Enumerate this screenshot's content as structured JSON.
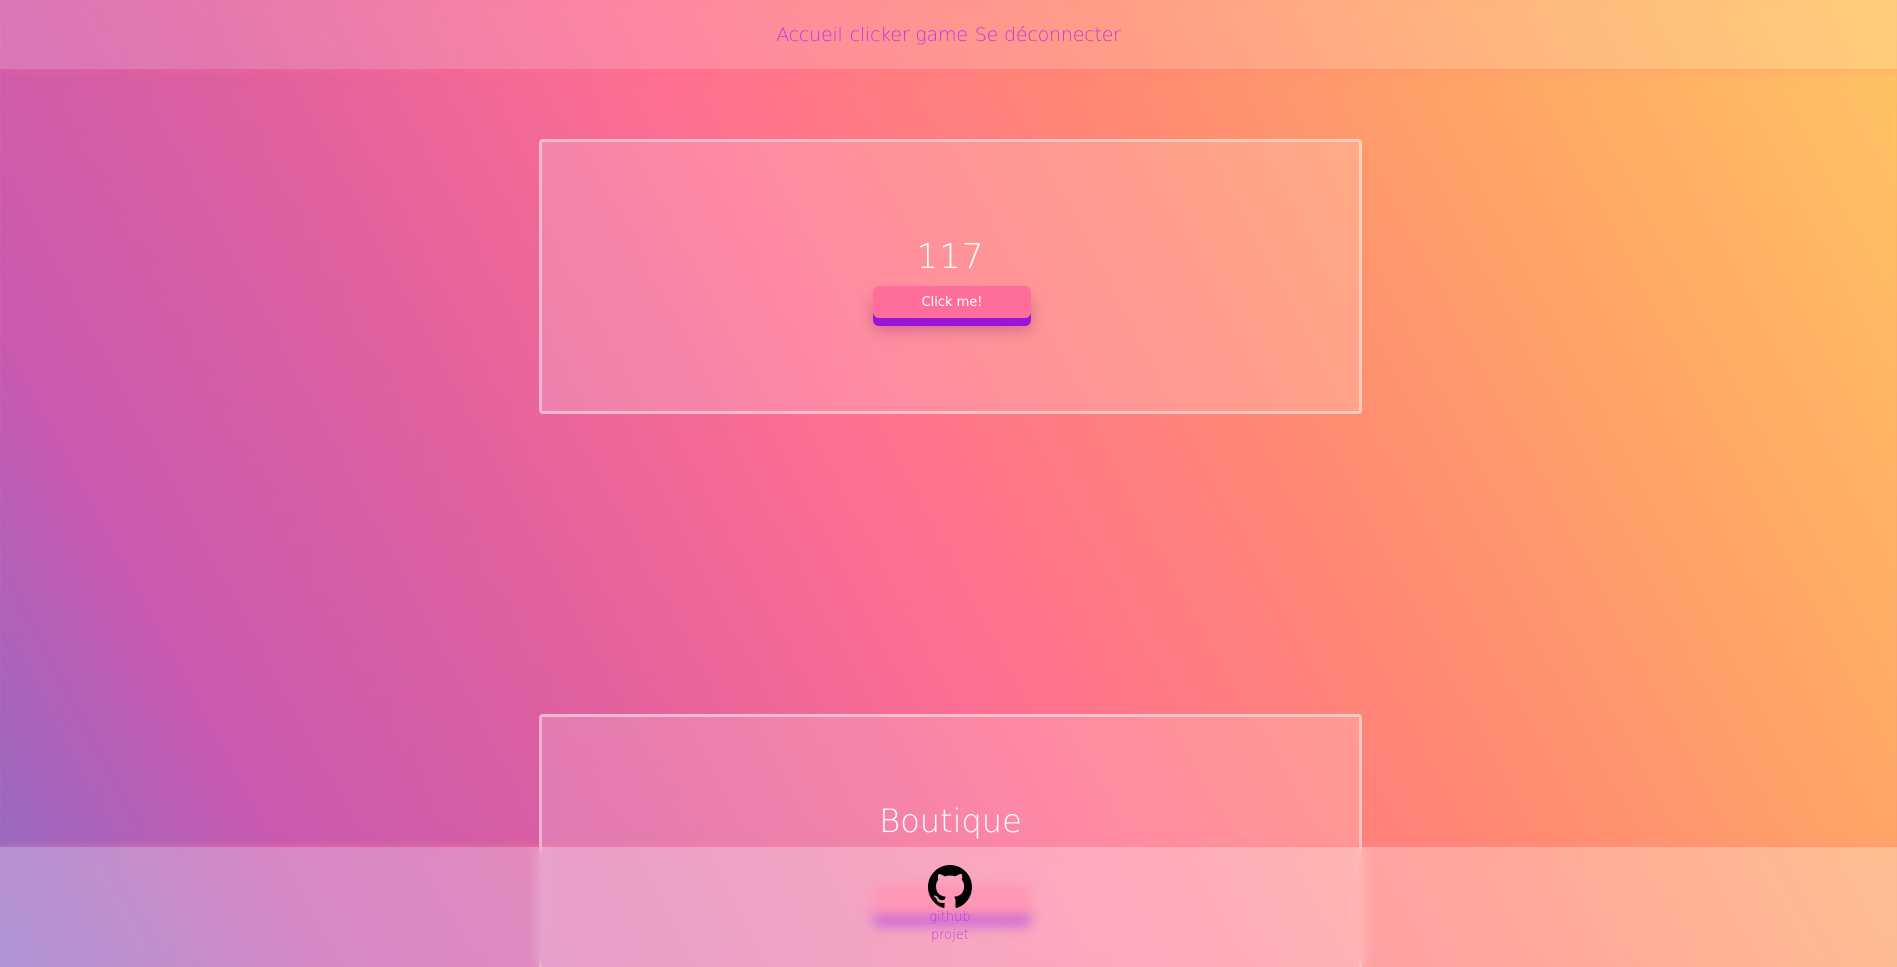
{
  "nav": {
    "home": "Accueil",
    "game": "clicker game",
    "logout": "Se déconnecter"
  },
  "clicker": {
    "count": "117",
    "button_label": "Click me!"
  },
  "shop": {
    "title": "Boutique"
  },
  "footer": {
    "github_icon": "github-icon",
    "github_label_line1": "github",
    "github_label_line2": "projet"
  },
  "colors": {
    "accent": "#c037e0",
    "button": "#ff6e9a",
    "button_shadow": "#9b15d6"
  }
}
